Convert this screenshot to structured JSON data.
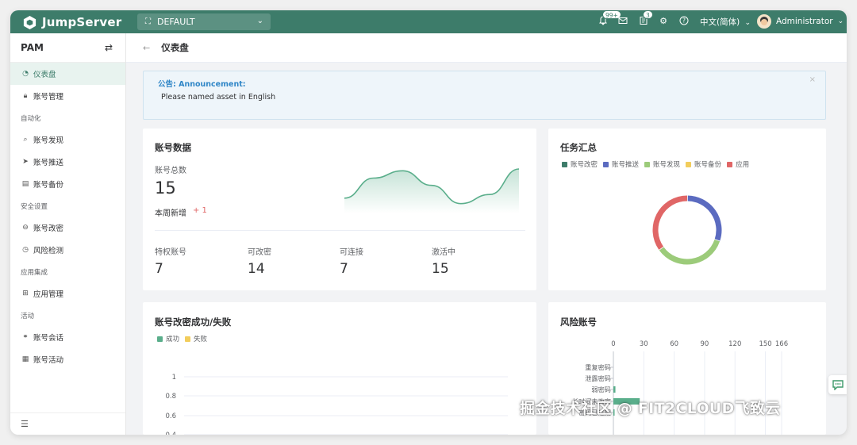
{
  "app": {
    "brand": "JumpServer"
  },
  "topnav": {
    "org": "DEFAULT",
    "notice_badge": "99+",
    "ticket_badge": "3",
    "language": "中文(简体)",
    "user": "Administrator"
  },
  "sidebar": {
    "title": "PAM",
    "items": [
      {
        "type": "item",
        "label": "仪表盘",
        "icon": "dashboard-icon",
        "active": true
      },
      {
        "type": "item",
        "label": "账号管理",
        "icon": "lock-icon"
      },
      {
        "type": "group",
        "label": "自动化"
      },
      {
        "type": "item",
        "label": "账号发现",
        "icon": "search-icon"
      },
      {
        "type": "item",
        "label": "账号推送",
        "icon": "send-icon"
      },
      {
        "type": "item",
        "label": "账号备份",
        "icon": "backup-icon"
      },
      {
        "type": "group",
        "label": "安全设置"
      },
      {
        "type": "item",
        "label": "账号改密",
        "icon": "key-lock-icon"
      },
      {
        "type": "item",
        "label": "风险检测",
        "icon": "gauge-icon"
      },
      {
        "type": "group",
        "label": "应用集成"
      },
      {
        "type": "item",
        "label": "应用管理",
        "icon": "apps-icon"
      },
      {
        "type": "group",
        "label": "活动"
      },
      {
        "type": "item",
        "label": "账号会话",
        "icon": "link-icon"
      },
      {
        "type": "item",
        "label": "账号活动",
        "icon": "calendar-icon"
      }
    ]
  },
  "page": {
    "title": "仪表盘"
  },
  "announcement": {
    "heading": "公告: Announcement:",
    "text": "Please named asset in English"
  },
  "account_data": {
    "title": "账号数据",
    "total_label": "账号总数",
    "total_value": "15",
    "weekly_new_label": "本周新增",
    "weekly_new_value": "+ 1",
    "stats": [
      {
        "label": "特权账号",
        "value": "7"
      },
      {
        "label": "可改密",
        "value": "14"
      },
      {
        "label": "可连接",
        "value": "7"
      },
      {
        "label": "激活中",
        "value": "15"
      }
    ]
  },
  "task_summary": {
    "title": "任务汇总",
    "legend": [
      {
        "label": "账号改密",
        "color": "#3d7c6a"
      },
      {
        "label": "账号推送",
        "color": "#5b6bc0"
      },
      {
        "label": "账号发现",
        "color": "#9ccb7a"
      },
      {
        "label": "账号备份",
        "color": "#f2cd5c"
      },
      {
        "label": "应用",
        "color": "#e06666"
      }
    ]
  },
  "change_secret": {
    "title": "账号改密成功/失败",
    "legend": [
      {
        "label": "成功",
        "color": "#5aae8b"
      },
      {
        "label": "失败",
        "color": "#f2cd5c"
      }
    ],
    "y_ticks": [
      "1",
      "0.8",
      "0.6",
      "0.4"
    ]
  },
  "risk_accounts": {
    "title": "风险账号",
    "x_ticks": [
      "0",
      "30",
      "60",
      "90",
      "120",
      "150",
      "166"
    ],
    "categories": [
      "重复密码",
      "泄露密码",
      "弱密码",
      "长时间未改密",
      "密码已过期"
    ]
  },
  "watermark": "掘金技术社区 @ FIT2CLOUD飞致云",
  "chart_data": [
    {
      "type": "area",
      "title": "",
      "x": [
        0,
        1,
        2,
        3,
        4,
        5,
        6
      ],
      "series": [
        {
          "values": [
            0.2,
            0.75,
            0.95,
            0.55,
            0.05,
            0.3,
            1.0
          ]
        }
      ]
    },
    {
      "type": "pie",
      "title": "任务汇总",
      "donut": true,
      "categories": [
        "账号改密",
        "账号推送",
        "账号发现",
        "账号备份",
        "应用"
      ],
      "values": [
        0,
        30,
        35,
        0,
        35
      ]
    },
    {
      "type": "line",
      "title": "账号改密成功/失败",
      "series": [
        {
          "name": "成功",
          "values": []
        },
        {
          "name": "失败",
          "values": []
        }
      ],
      "ylim": [
        0.4,
        1
      ]
    },
    {
      "type": "bar",
      "title": "风险账号",
      "orientation": "horizontal",
      "categories": [
        "重复密码",
        "泄露密码",
        "弱密码",
        "长时间未改密",
        "密码已过期"
      ],
      "values": [
        0,
        0,
        2,
        26,
        1
      ],
      "xlim": [
        0,
        166
      ]
    }
  ]
}
